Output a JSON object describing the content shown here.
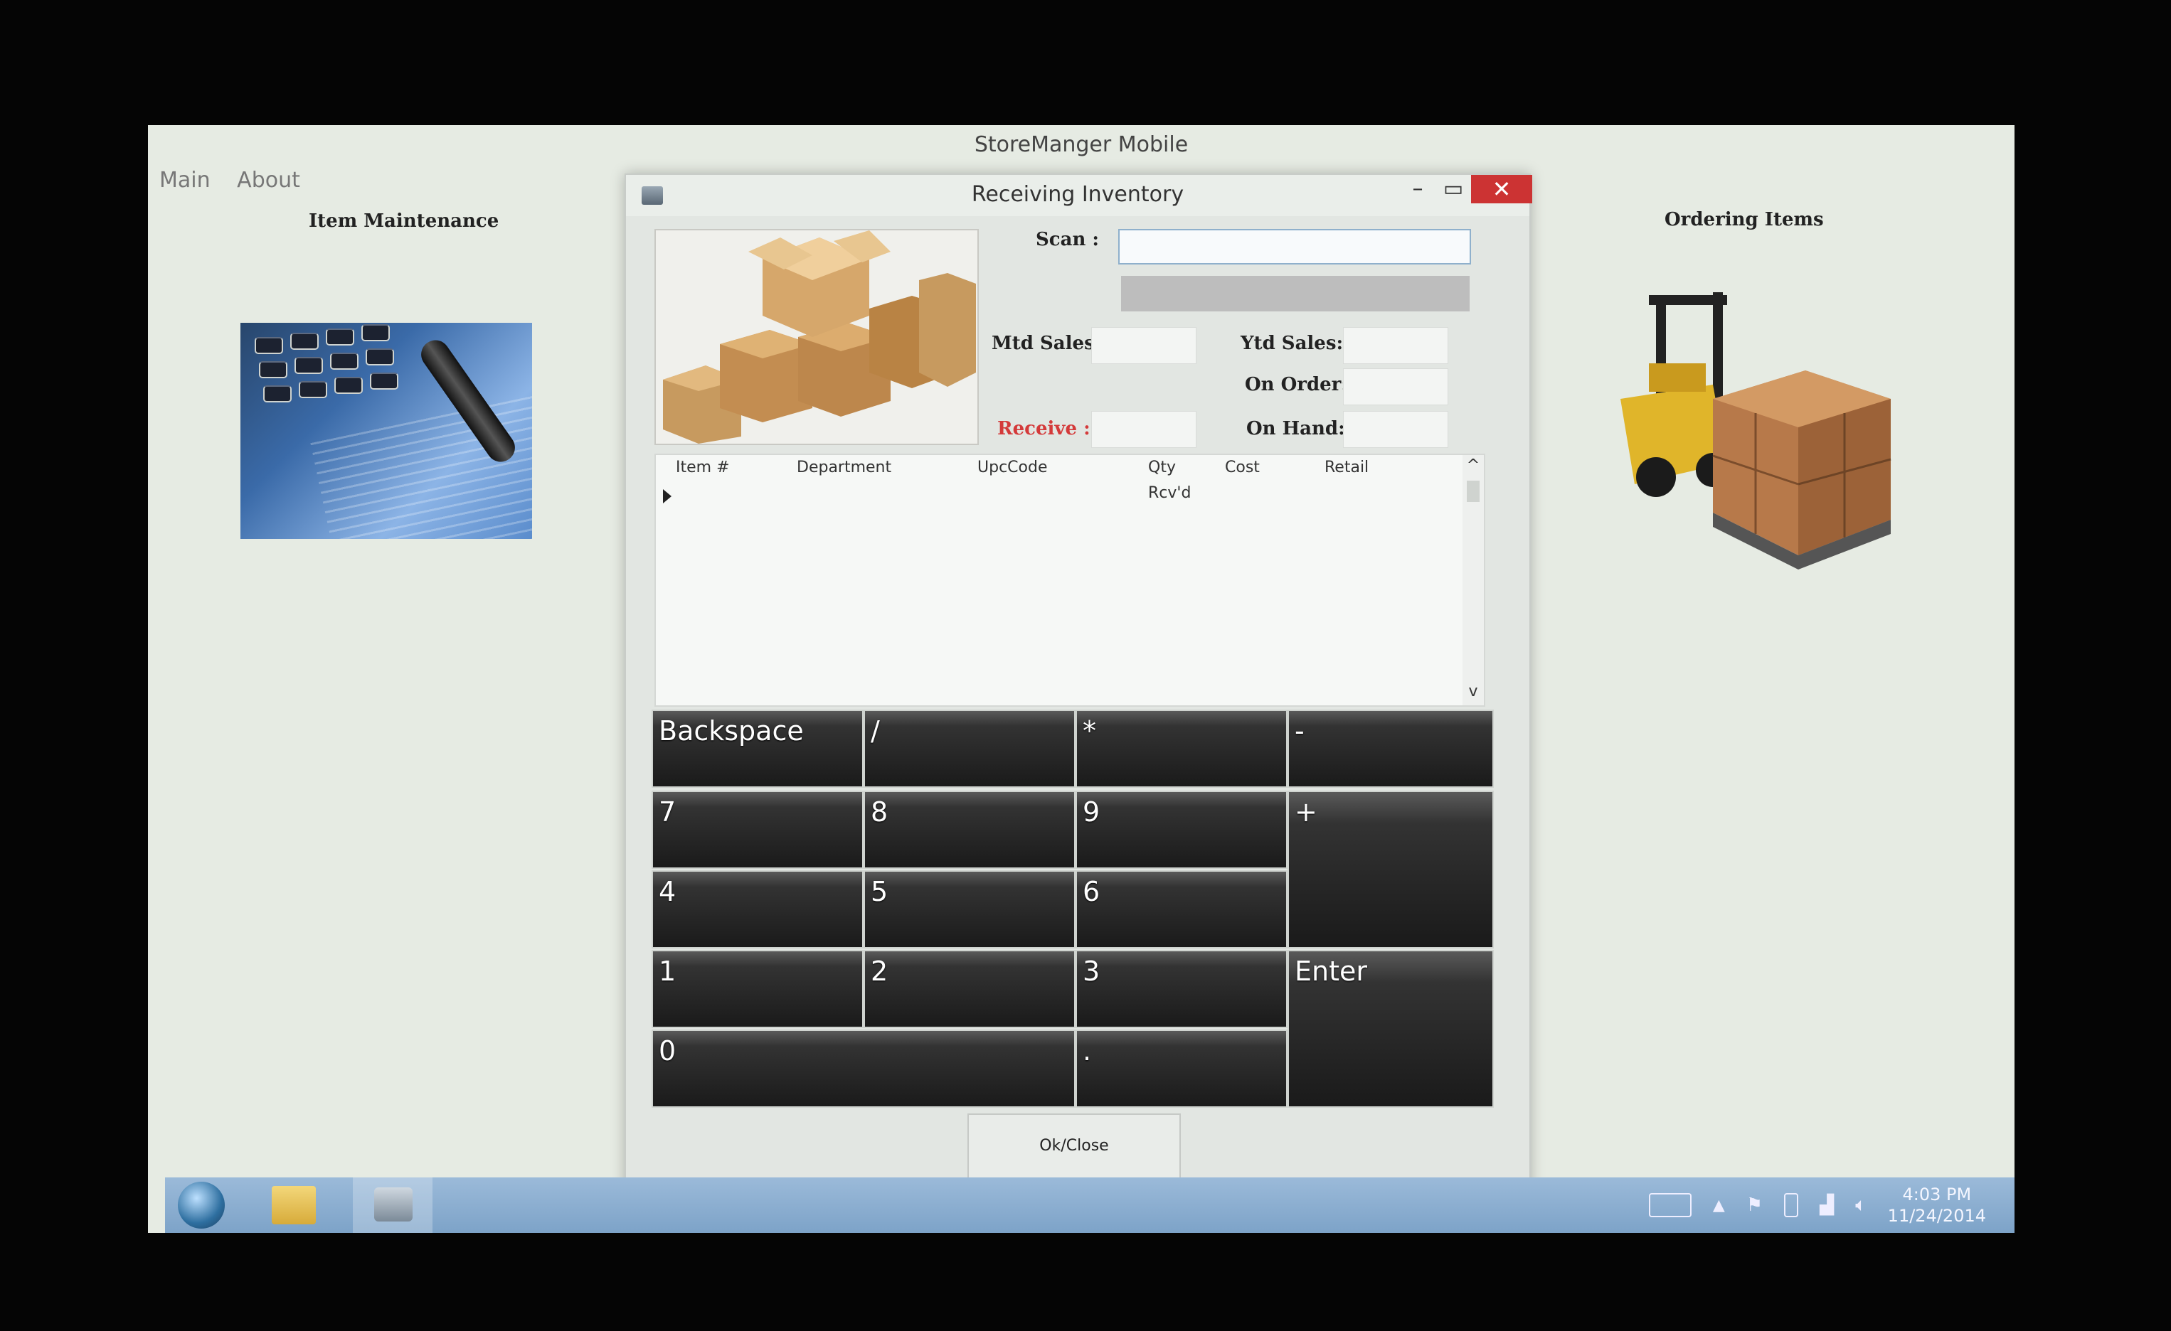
{
  "app": {
    "title": "StoreManger Mobile",
    "menu": [
      "Main",
      "About"
    ],
    "left_section_title": "Item Maintenance",
    "right_section_title": "Ordering Items"
  },
  "dialog": {
    "title": "Receiving Inventory",
    "minimize_label": "–",
    "maximize_label": "▭",
    "close_label": "✕",
    "scan_label": "Scan :",
    "scan_value": "",
    "mtd_sales_label": "Mtd Sales:",
    "ytd_sales_label": "Ytd Sales:",
    "on_order_label": "On Order:",
    "receive_label": "Receive :",
    "on_hand_label": "On Hand:",
    "grid": {
      "columns": [
        "Item #",
        "Department",
        "UpcCode",
        "Qty Rcv'd",
        "Cost",
        "Retail"
      ],
      "rows": [],
      "scroll_up": "^",
      "scroll_down": "v"
    },
    "keypad": {
      "backspace": "Backspace",
      "divide": "/",
      "multiply": "*",
      "minus": "-",
      "seven": "7",
      "eight": "8",
      "nine": "9",
      "plus": "+",
      "four": "4",
      "five": "5",
      "six": "6",
      "one": "1",
      "two": "2",
      "three": "3",
      "enter": "Enter",
      "zero": "0",
      "decimal": "."
    },
    "ok_close_label": "Ok/Close"
  },
  "taskbar": {
    "time": "4:03 PM",
    "date": "11/24/2014"
  },
  "colors": {
    "close_button": "#cc3333",
    "receive_label": "#d43a3a",
    "taskbar": "#8fb0d2"
  }
}
